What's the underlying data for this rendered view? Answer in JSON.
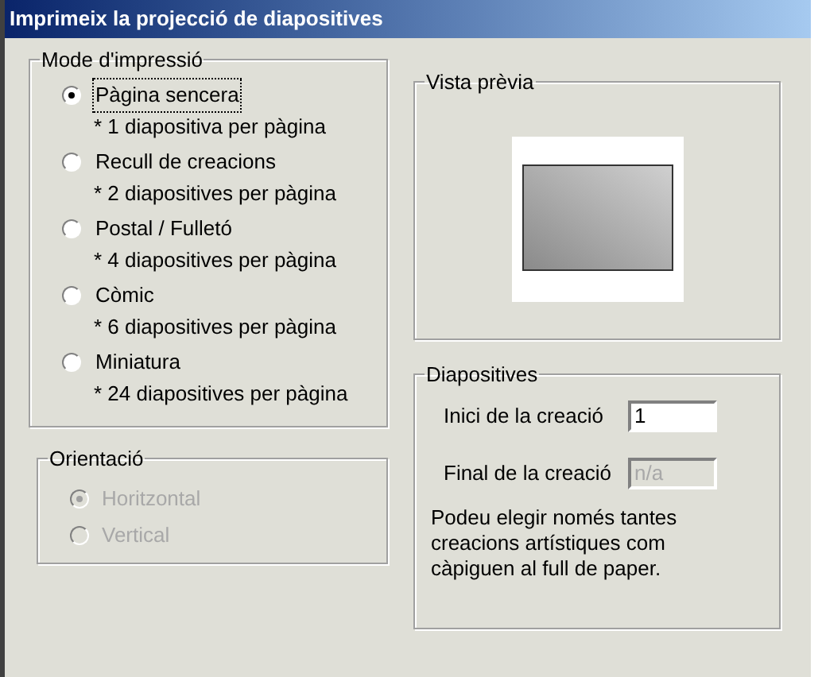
{
  "window": {
    "title": "Imprimeix la projecció de diapositives"
  },
  "print_mode": {
    "label": "Mode d'impressió",
    "options": [
      {
        "label": "Pàgina sencera",
        "note": "* 1 diapositiva per pàgina",
        "selected": true,
        "focused": true
      },
      {
        "label": "Recull de creacions",
        "note": "* 2 diapositives per pàgina",
        "selected": false,
        "focused": false
      },
      {
        "label": "Postal / Fulletó",
        "note": "* 4 diapositives per pàgina",
        "selected": false,
        "focused": false
      },
      {
        "label": "Còmic",
        "note": "* 6 diapositives per pàgina",
        "selected": false,
        "focused": false
      },
      {
        "label": "Miniatura",
        "note": "* 24 diapositives per pàgina",
        "selected": false,
        "focused": false
      }
    ]
  },
  "orientation": {
    "label": "Orientació",
    "disabled": true,
    "options": [
      {
        "label": "Horitzontal",
        "selected": true
      },
      {
        "label": "Vertical",
        "selected": false
      }
    ]
  },
  "preview": {
    "label": "Vista prèvia"
  },
  "slides": {
    "label": "Diapositives",
    "fields": [
      {
        "label": "Inici de la creació",
        "value": "1",
        "disabled": false
      },
      {
        "label": "Final de la creació",
        "value": "n/a",
        "disabled": true
      }
    ],
    "note": "Podeu elegir només tantes creacions artístiques com càpiguen al full de paper."
  }
}
